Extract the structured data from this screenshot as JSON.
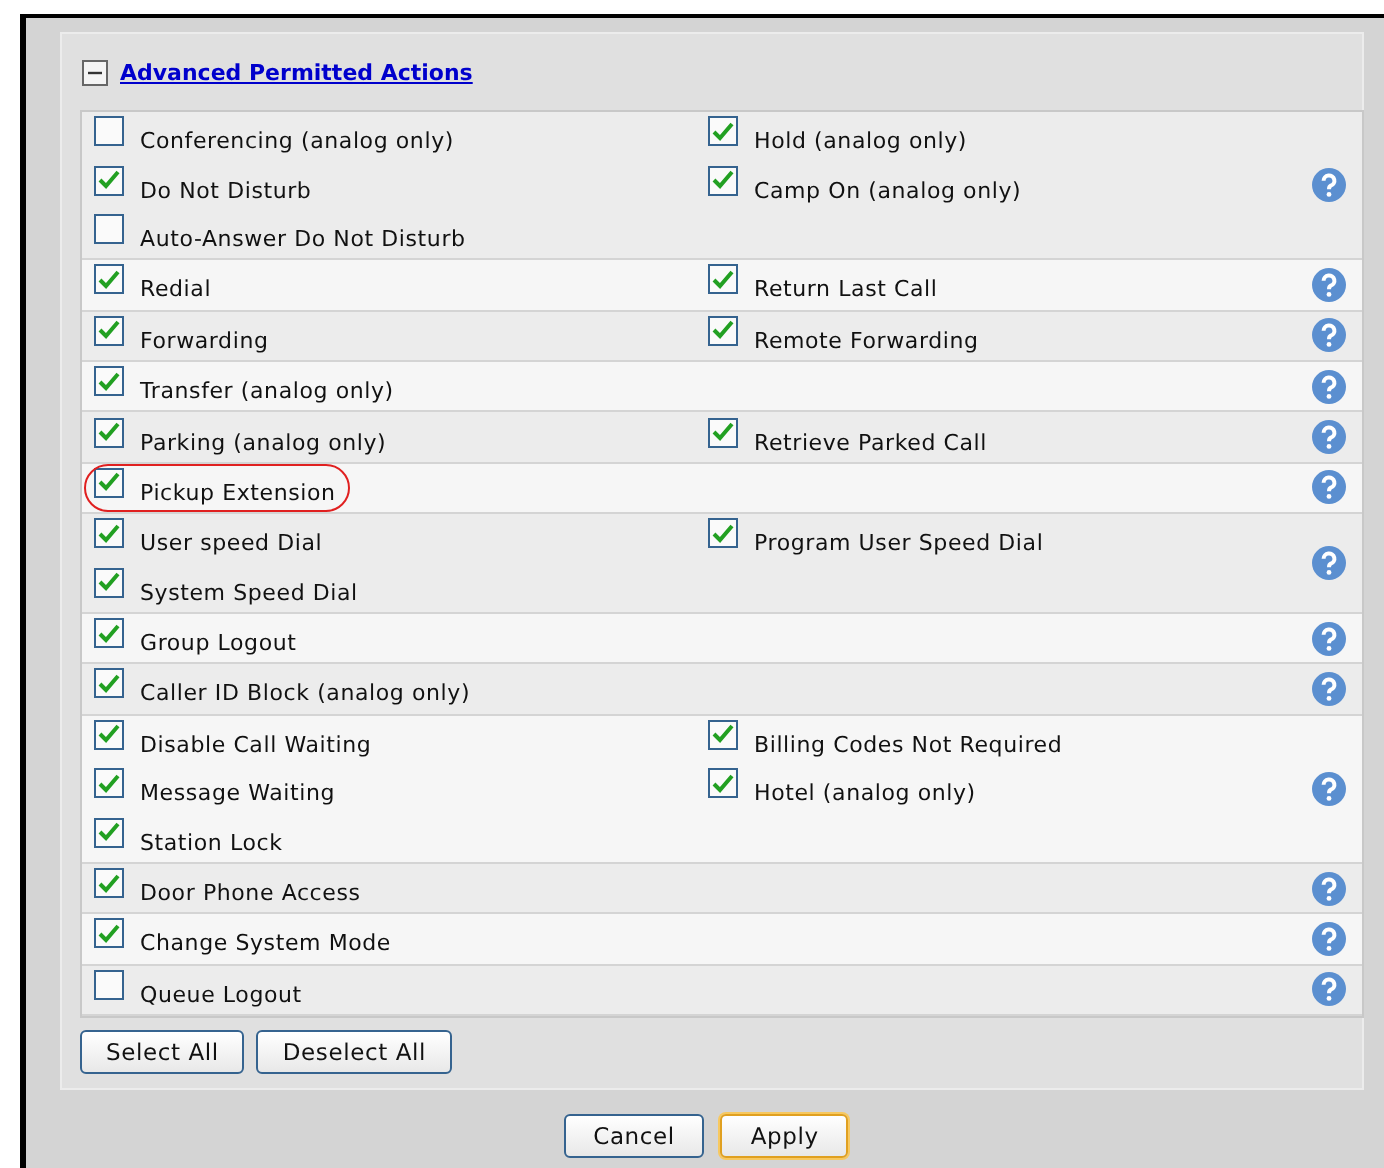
{
  "section": {
    "title": "Advanced Permitted Actions",
    "expanded": true
  },
  "groups": [
    {
      "left": [
        {
          "label": "Conferencing (analog only)",
          "checked": false
        },
        {
          "label": "Do Not Disturb",
          "checked": true
        },
        {
          "label": "Auto-Answer Do Not Disturb",
          "checked": false
        }
      ],
      "right": [
        {
          "label": "Hold (analog only)",
          "checked": true
        },
        {
          "label": "Camp On (analog only)",
          "checked": true
        }
      ]
    },
    {
      "left": [
        {
          "label": "Redial",
          "checked": true
        }
      ],
      "right": [
        {
          "label": "Return Last Call",
          "checked": true
        }
      ]
    },
    {
      "left": [
        {
          "label": "Forwarding",
          "checked": true
        }
      ],
      "right": [
        {
          "label": "Remote Forwarding",
          "checked": true
        }
      ]
    },
    {
      "left": [
        {
          "label": "Transfer (analog only)",
          "checked": true
        }
      ]
    },
    {
      "left": [
        {
          "label": "Parking (analog only)",
          "checked": true
        }
      ],
      "right": [
        {
          "label": "Retrieve Parked Call",
          "checked": true
        }
      ]
    },
    {
      "left": [
        {
          "label": "Pickup Extension",
          "checked": true,
          "highlighted": true
        }
      ]
    },
    {
      "left": [
        {
          "label": "User speed Dial",
          "checked": true
        },
        {
          "label": "System Speed Dial",
          "checked": true
        }
      ],
      "right": [
        {
          "label": "Program User Speed Dial",
          "checked": true
        }
      ]
    },
    {
      "left": [
        {
          "label": "Group Logout",
          "checked": true
        }
      ]
    },
    {
      "left": [
        {
          "label": "Caller ID Block (analog only)",
          "checked": true
        }
      ]
    },
    {
      "left": [
        {
          "label": "Disable Call Waiting",
          "checked": true
        },
        {
          "label": "Message Waiting",
          "checked": true
        },
        {
          "label": "Station Lock",
          "checked": true
        }
      ],
      "right": [
        {
          "label": "Billing Codes Not Required",
          "checked": true
        },
        {
          "label": "Hotel (analog only)",
          "checked": true
        }
      ]
    },
    {
      "left": [
        {
          "label": "Door Phone Access",
          "checked": true
        }
      ]
    },
    {
      "left": [
        {
          "label": "Change System Mode",
          "checked": true
        }
      ]
    },
    {
      "left": [
        {
          "label": "Queue Logout",
          "checked": false
        }
      ]
    }
  ],
  "panel_buttons": [
    "Select All",
    "Deselect All"
  ],
  "footer_buttons": [
    {
      "label": "Cancel",
      "focused": false
    },
    {
      "label": "Apply",
      "focused": true
    }
  ]
}
